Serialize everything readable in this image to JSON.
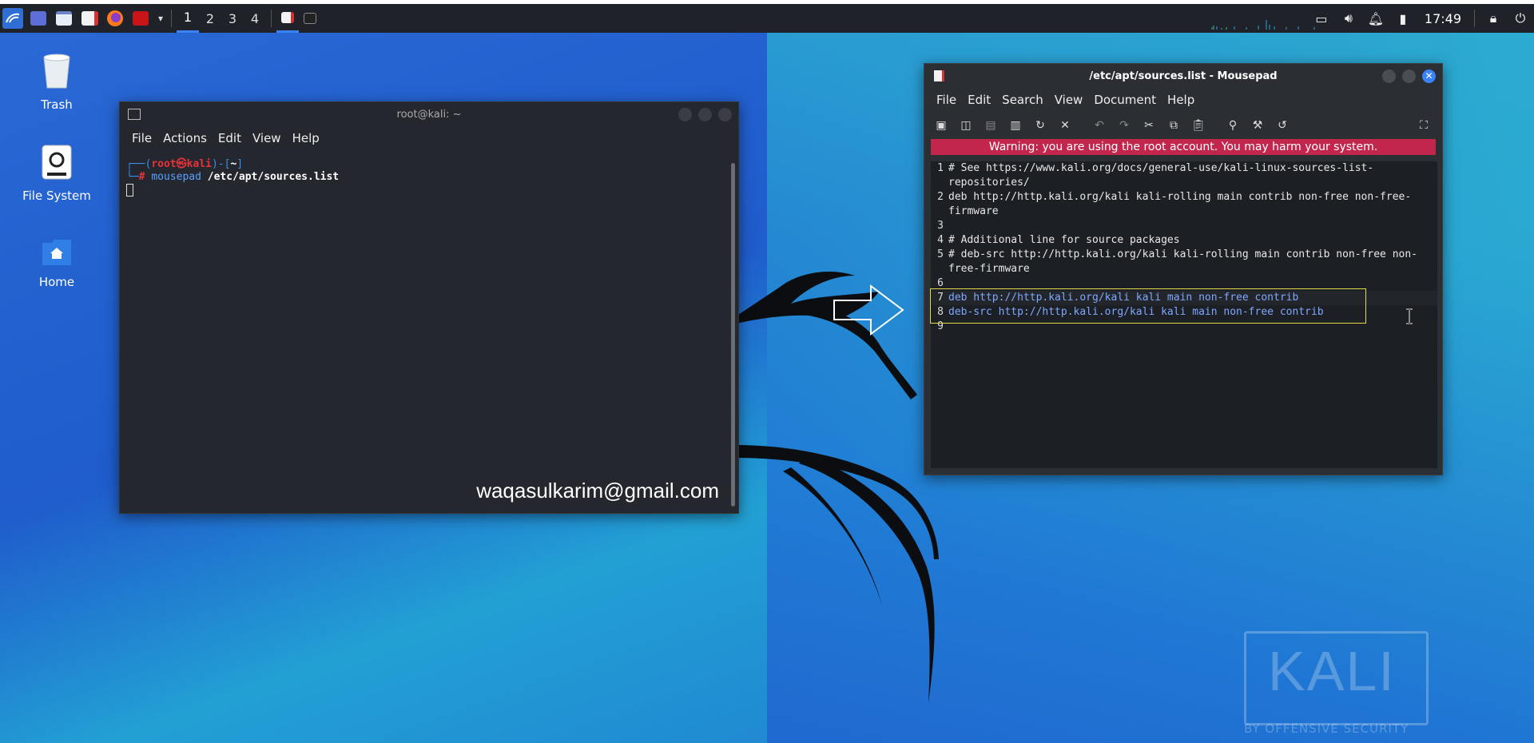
{
  "panel": {
    "workspaces": [
      "1",
      "2",
      "3",
      "4"
    ],
    "active_workspace": "1",
    "clock": "17:49",
    "tray_icons": [
      "display-icon",
      "volume-icon",
      "bell-icon",
      "battery-icon",
      "lock-icon",
      "power-icon"
    ]
  },
  "desktop": {
    "icons": [
      {
        "label": "Trash",
        "icon": "trash-icon"
      },
      {
        "label": "File System",
        "icon": "drive-icon"
      },
      {
        "label": "Home",
        "icon": "home-folder-icon"
      }
    ]
  },
  "terminal": {
    "title": "root@kali: ~",
    "menu": [
      "File",
      "Actions",
      "Edit",
      "View",
      "Help"
    ],
    "prompt_user": "root",
    "prompt_at": "㉿",
    "prompt_host": "kali",
    "prompt_dir": "~",
    "command": "mousepad",
    "command_arg": "/etc/apt/sources.list",
    "watermark": "waqasulkarim@gmail.com"
  },
  "mousepad": {
    "title": "/etc/apt/sources.list - Mousepad",
    "menu": [
      "File",
      "Edit",
      "Search",
      "View",
      "Document",
      "Help"
    ],
    "warning": "Warning: you are using the root account. You may harm your system.",
    "lines": [
      {
        "n": "1",
        "text": "# See https://www.kali.org/docs/general-use/kali-linux-sources-list-repositories/"
      },
      {
        "n": "2",
        "text": "deb http://http.kali.org/kali kali-rolling main contrib non-free non-free-firmware"
      },
      {
        "n": "3",
        "text": ""
      },
      {
        "n": "4",
        "text": "# Additional line for source packages"
      },
      {
        "n": "5",
        "text": "# deb-src http://http.kali.org/kali kali-rolling main contrib non-free non-free-firmware"
      },
      {
        "n": "6",
        "text": ""
      },
      {
        "n": "7",
        "text": "deb http://http.kali.org/kali kali main non-free contrib"
      },
      {
        "n": "8",
        "text": "deb-src http://http.kali.org/kali kali main non-free contrib"
      },
      {
        "n": "9",
        "text": ""
      }
    ]
  },
  "wallpaper": {
    "logo_text": "KALI",
    "logo_sub": "BY OFFENSIVE SECURITY"
  },
  "colors": {
    "accent": "#3b82f6",
    "warning_bg": "#c2264d",
    "prompt_red": "#e8323c",
    "prompt_blue": "#3b8eea",
    "highlight_box": "#e5d84a"
  }
}
